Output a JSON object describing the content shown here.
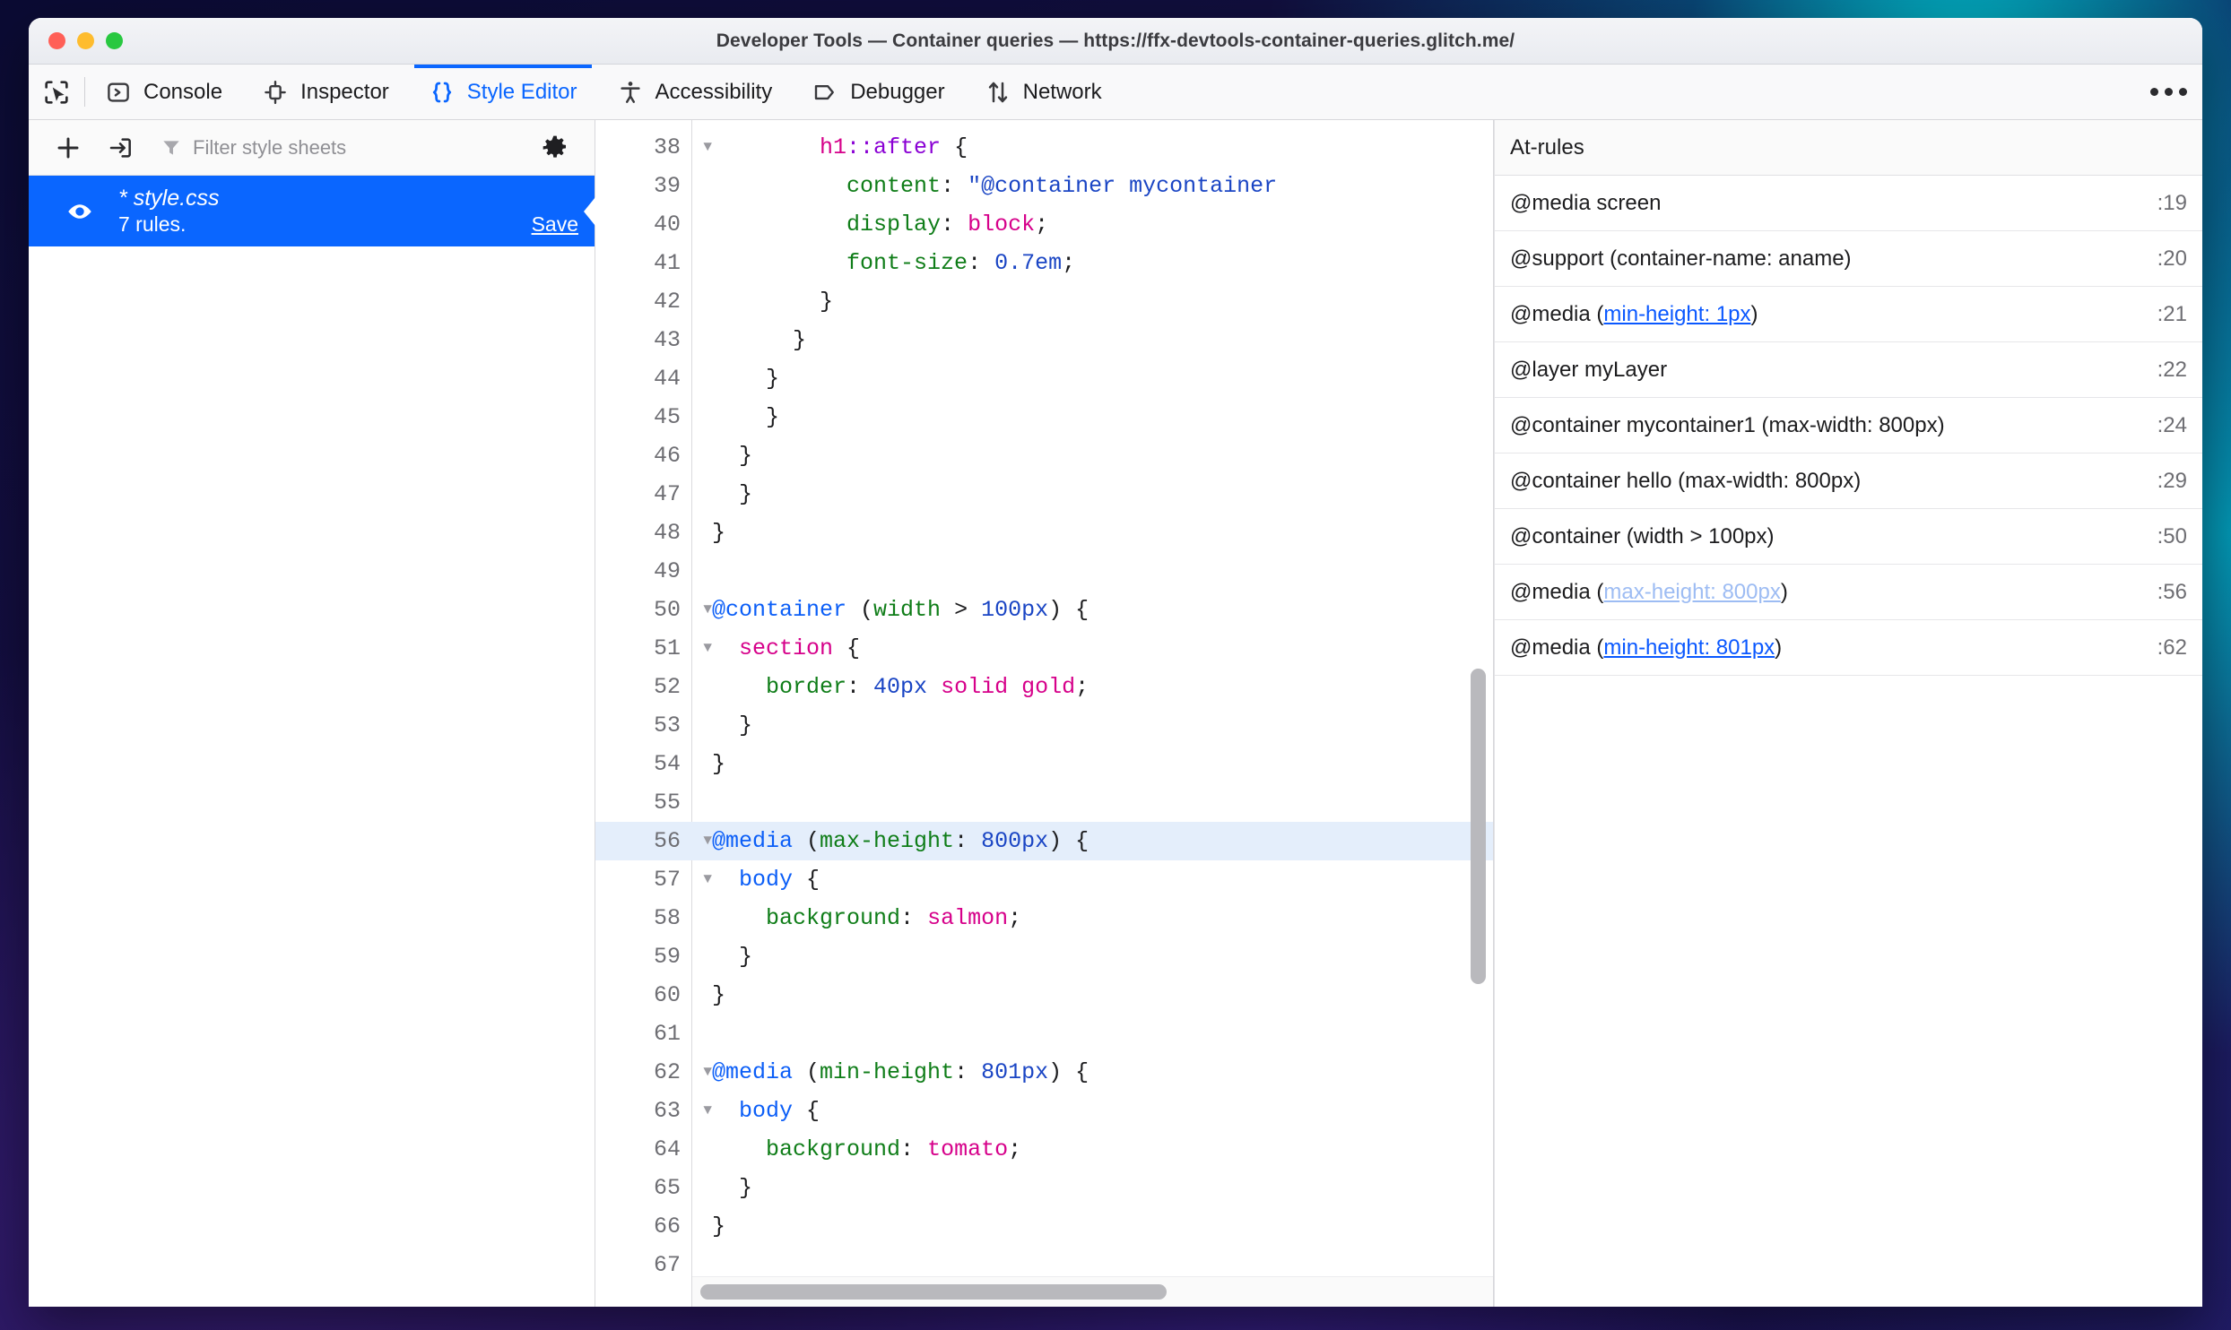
{
  "window": {
    "title": "Developer Tools — Container queries — https://ffx-devtools-container-queries.glitch.me/"
  },
  "toolbar": {
    "picker_icon": "element-picker-icon",
    "overflow_icon": "more-options-icon",
    "tabs": [
      {
        "label": "Console",
        "icon": "console-icon",
        "active": false
      },
      {
        "label": "Inspector",
        "icon": "inspector-icon",
        "active": false
      },
      {
        "label": "Style Editor",
        "icon": "braces-icon",
        "active": true
      },
      {
        "label": "Accessibility",
        "icon": "accessibility-icon",
        "active": false
      },
      {
        "label": "Debugger",
        "icon": "debugger-icon",
        "active": false
      },
      {
        "label": "Network",
        "icon": "network-icon",
        "active": false
      }
    ]
  },
  "sidebar": {
    "new_icon": "plus-icon",
    "import_icon": "import-stylesheet-icon",
    "filter_icon": "filter-icon",
    "filter_placeholder": "Filter style sheets",
    "settings_icon": "gear-icon",
    "stylesheet": {
      "visibility_icon": "eye-icon",
      "modified_marker": "*",
      "name": "style.css",
      "rules_label": "7 rules.",
      "save_label": "Save",
      "selected": true,
      "accent_color": "#0a66ff"
    }
  },
  "editor": {
    "first_line": 38,
    "highlighted_line": 56,
    "lines": [
      {
        "n": 38,
        "fold": true,
        "indent": 4,
        "tokens": [
          {
            "t": "h1",
            "c": "t-sel"
          },
          {
            "t": "::after",
            "c": "t-pseudo"
          },
          {
            "t": " {",
            "c": "t-plain"
          }
        ]
      },
      {
        "n": 39,
        "fold": false,
        "indent": 5,
        "tokens": [
          {
            "t": "content",
            "c": "t-prop"
          },
          {
            "t": ": ",
            "c": "t-plain"
          },
          {
            "t": "\"@container mycontainer",
            "c": "t-str"
          }
        ]
      },
      {
        "n": 40,
        "fold": false,
        "indent": 5,
        "tokens": [
          {
            "t": "display",
            "c": "t-prop"
          },
          {
            "t": ": ",
            "c": "t-plain"
          },
          {
            "t": "block",
            "c": "t-val"
          },
          {
            "t": ";",
            "c": "t-plain"
          }
        ]
      },
      {
        "n": 41,
        "fold": false,
        "indent": 5,
        "tokens": [
          {
            "t": "font-size",
            "c": "t-prop"
          },
          {
            "t": ": ",
            "c": "t-plain"
          },
          {
            "t": "0.7em",
            "c": "t-num"
          },
          {
            "t": ";",
            "c": "t-plain"
          }
        ]
      },
      {
        "n": 42,
        "fold": false,
        "indent": 4,
        "tokens": [
          {
            "t": "}",
            "c": "t-plain"
          }
        ]
      },
      {
        "n": 43,
        "fold": false,
        "indent": 3,
        "tokens": [
          {
            "t": "}",
            "c": "t-plain"
          }
        ]
      },
      {
        "n": 44,
        "fold": false,
        "indent": 2,
        "tokens": [
          {
            "t": "}",
            "c": "t-plain"
          }
        ]
      },
      {
        "n": 45,
        "fold": false,
        "indent": 2,
        "tokens": [
          {
            "t": "}",
            "c": "t-plain"
          }
        ]
      },
      {
        "n": 46,
        "fold": false,
        "indent": 1,
        "tokens": [
          {
            "t": "}",
            "c": "t-plain"
          }
        ]
      },
      {
        "n": 47,
        "fold": false,
        "indent": 1,
        "tokens": [
          {
            "t": "}",
            "c": "t-plain"
          }
        ]
      },
      {
        "n": 48,
        "fold": false,
        "indent": 0,
        "tokens": [
          {
            "t": "}",
            "c": "t-plain"
          }
        ]
      },
      {
        "n": 49,
        "fold": false,
        "indent": 0,
        "tokens": []
      },
      {
        "n": 50,
        "fold": true,
        "indent": 0,
        "tokens": [
          {
            "t": "@container",
            "c": "t-at"
          },
          {
            "t": " (",
            "c": "t-plain"
          },
          {
            "t": "width",
            "c": "t-feat"
          },
          {
            "t": " > ",
            "c": "t-plain"
          },
          {
            "t": "100px",
            "c": "t-num"
          },
          {
            "t": ") {",
            "c": "t-plain"
          }
        ]
      },
      {
        "n": 51,
        "fold": true,
        "indent": 1,
        "tokens": [
          {
            "t": "section",
            "c": "t-sel"
          },
          {
            "t": " {",
            "c": "t-plain"
          }
        ]
      },
      {
        "n": 52,
        "fold": false,
        "indent": 2,
        "tokens": [
          {
            "t": "border",
            "c": "t-prop"
          },
          {
            "t": ": ",
            "c": "t-plain"
          },
          {
            "t": "40px",
            "c": "t-num"
          },
          {
            "t": " ",
            "c": "t-plain"
          },
          {
            "t": "solid",
            "c": "t-val"
          },
          {
            "t": " ",
            "c": "t-plain"
          },
          {
            "t": "gold",
            "c": "t-val"
          },
          {
            "t": ";",
            "c": "t-plain"
          }
        ]
      },
      {
        "n": 53,
        "fold": false,
        "indent": 1,
        "tokens": [
          {
            "t": "}",
            "c": "t-plain"
          }
        ]
      },
      {
        "n": 54,
        "fold": false,
        "indent": 0,
        "tokens": [
          {
            "t": "}",
            "c": "t-plain"
          }
        ]
      },
      {
        "n": 55,
        "fold": false,
        "indent": 0,
        "tokens": []
      },
      {
        "n": 56,
        "fold": true,
        "indent": 0,
        "highlight": true,
        "tokens": [
          {
            "t": "@media",
            "c": "t-at"
          },
          {
            "t": " (",
            "c": "t-plain"
          },
          {
            "t": "max-height",
            "c": "t-feat"
          },
          {
            "t": ": ",
            "c": "t-plain"
          },
          {
            "t": "800px",
            "c": "t-num"
          },
          {
            "t": ") {",
            "c": "t-plain"
          }
        ]
      },
      {
        "n": 57,
        "fold": true,
        "indent": 1,
        "tokens": [
          {
            "t": "body",
            "c": "t-at"
          },
          {
            "t": " {",
            "c": "t-plain"
          }
        ]
      },
      {
        "n": 58,
        "fold": false,
        "indent": 2,
        "tokens": [
          {
            "t": "background",
            "c": "t-prop"
          },
          {
            "t": ": ",
            "c": "t-plain"
          },
          {
            "t": "salmon",
            "c": "t-val"
          },
          {
            "t": ";",
            "c": "t-plain"
          }
        ]
      },
      {
        "n": 59,
        "fold": false,
        "indent": 1,
        "tokens": [
          {
            "t": "}",
            "c": "t-plain"
          }
        ]
      },
      {
        "n": 60,
        "fold": false,
        "indent": 0,
        "tokens": [
          {
            "t": "}",
            "c": "t-plain"
          }
        ]
      },
      {
        "n": 61,
        "fold": false,
        "indent": 0,
        "tokens": []
      },
      {
        "n": 62,
        "fold": true,
        "indent": 0,
        "tokens": [
          {
            "t": "@media",
            "c": "t-at"
          },
          {
            "t": " (",
            "c": "t-plain"
          },
          {
            "t": "min-height",
            "c": "t-feat"
          },
          {
            "t": ": ",
            "c": "t-plain"
          },
          {
            "t": "801px",
            "c": "t-num"
          },
          {
            "t": ") {",
            "c": "t-plain"
          }
        ]
      },
      {
        "n": 63,
        "fold": true,
        "indent": 1,
        "tokens": [
          {
            "t": "body",
            "c": "t-at"
          },
          {
            "t": " {",
            "c": "t-plain"
          }
        ]
      },
      {
        "n": 64,
        "fold": false,
        "indent": 2,
        "tokens": [
          {
            "t": "background",
            "c": "t-prop"
          },
          {
            "t": ": ",
            "c": "t-plain"
          },
          {
            "t": "tomato",
            "c": "t-val"
          },
          {
            "t": ";",
            "c": "t-plain"
          }
        ]
      },
      {
        "n": 65,
        "fold": false,
        "indent": 1,
        "tokens": [
          {
            "t": "}",
            "c": "t-plain"
          }
        ]
      },
      {
        "n": 66,
        "fold": false,
        "indent": 0,
        "tokens": [
          {
            "t": "}",
            "c": "t-plain"
          }
        ]
      },
      {
        "n": 67,
        "fold": false,
        "indent": 0,
        "tokens": []
      }
    ]
  },
  "at_rules": {
    "header": "At-rules",
    "rows": [
      {
        "parts": [
          {
            "t": "@media screen",
            "link": false
          }
        ],
        "line": ":19"
      },
      {
        "parts": [
          {
            "t": "@support (container-name: aname)",
            "link": false
          }
        ],
        "line": ":20"
      },
      {
        "parts": [
          {
            "t": "@media (",
            "link": false
          },
          {
            "t": "min-height: 1px",
            "link": true
          },
          {
            "t": ")",
            "link": false
          }
        ],
        "line": ":21"
      },
      {
        "parts": [
          {
            "t": "@layer myLayer",
            "link": false
          }
        ],
        "line": ":22"
      },
      {
        "parts": [
          {
            "t": "@container mycontainer1 (max-width: 800px)",
            "link": false
          }
        ],
        "line": ":24"
      },
      {
        "parts": [
          {
            "t": "@container hello (max-width: 800px)",
            "link": false
          }
        ],
        "line": ":29"
      },
      {
        "parts": [
          {
            "t": "@container (width > 100px)",
            "link": false
          }
        ],
        "line": ":50"
      },
      {
        "parts": [
          {
            "t": "@media (",
            "link": false
          },
          {
            "t": "max-height: 800px",
            "link": true,
            "dim": true
          },
          {
            "t": ")",
            "link": false
          }
        ],
        "line": ":56"
      },
      {
        "parts": [
          {
            "t": "@media (",
            "link": false
          },
          {
            "t": "min-height: 801px",
            "link": true
          },
          {
            "t": ")",
            "link": false
          }
        ],
        "line": ":62"
      }
    ]
  },
  "colors": {
    "accent": "#0a66ff",
    "link": "#0a58ff",
    "link_dim": "#9dbcf3",
    "selected_line": "#e4eefb"
  }
}
